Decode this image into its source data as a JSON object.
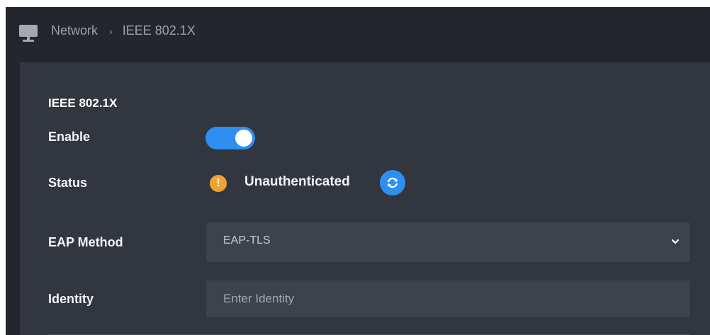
{
  "breadcrumb": {
    "root": "Network",
    "current": "IEEE 802.1X"
  },
  "section": {
    "title": "IEEE 802.1X"
  },
  "enable": {
    "label": "Enable",
    "checked": true
  },
  "status": {
    "label": "Status",
    "value": "Unauthenticated",
    "warning_glyph": "!"
  },
  "eap_method": {
    "label": "EAP Method",
    "selected": "EAP-TLS"
  },
  "identity": {
    "label": "Identity",
    "placeholder": "Enter Identity",
    "value": ""
  },
  "icons": {
    "nav": "monitor-icon",
    "separator": "chevron-right-icon",
    "status": "warning-icon",
    "refresh": "refresh-icon",
    "dropdown": "chevron-down-icon"
  },
  "colors": {
    "accent": "#2f8ff0",
    "warning": "#f1a233",
    "background": "#23262c",
    "panel": "#32363f",
    "field": "#3d424c"
  }
}
